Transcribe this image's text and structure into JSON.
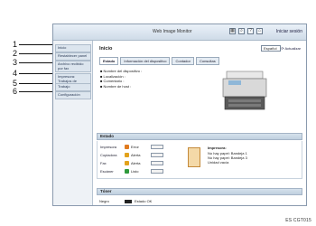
{
  "window": {
    "title": "Web Image Monitor",
    "login_label": "Iniciar sesión"
  },
  "top_icons": [
    "grid-icon",
    "search-icon",
    "question-icon",
    "home-icon"
  ],
  "sidebar": {
    "items": [
      {
        "label": "Inicio"
      },
      {
        "label": "Restablecer panel"
      },
      {
        "label": "Archivo recibido por fax"
      },
      {
        "label": "Impresora: Trabajos de impresión"
      },
      {
        "label": "Trabajo"
      },
      {
        "label": "Configuración"
      }
    ]
  },
  "callouts": [
    "1",
    "2",
    "3",
    "4",
    "5",
    "6"
  ],
  "main": {
    "title": "Inicio",
    "language": "Español",
    "refresh_label": "Actualizar",
    "tabs": [
      {
        "label": "Estado",
        "active": true
      },
      {
        "label": "Información del dispositivo",
        "active": false
      },
      {
        "label": "Contador",
        "active": false
      },
      {
        "label": "Consultas",
        "active": false
      }
    ],
    "info": [
      "Nombre del dispositivo :",
      "Localización :",
      "Comentario :",
      "Nombre de host :"
    ]
  },
  "status": {
    "heading": "Estado",
    "rows": [
      {
        "label": "Impresora",
        "value": "Error",
        "icon_color": "#e07b1f"
      },
      {
        "label": "Copiadora",
        "value": "Alerta",
        "icon_color": "#e2a21c"
      },
      {
        "label": "Fax",
        "value": "Alerta",
        "icon_color": "#e2a21c"
      },
      {
        "label": "Escáner",
        "value": "Listo",
        "icon_color": "#2f9a3c"
      }
    ],
    "messages_title": "Impresora:",
    "messages": [
      "No hay papel: Bandeja 1",
      "No hay papel: Bandeja 3",
      "Unidad vacía"
    ]
  },
  "toner": {
    "heading": "Tóner",
    "rows": [
      {
        "label": "Negro",
        "value": "Estado OK"
      }
    ]
  },
  "figure_code": "ES CGT015"
}
